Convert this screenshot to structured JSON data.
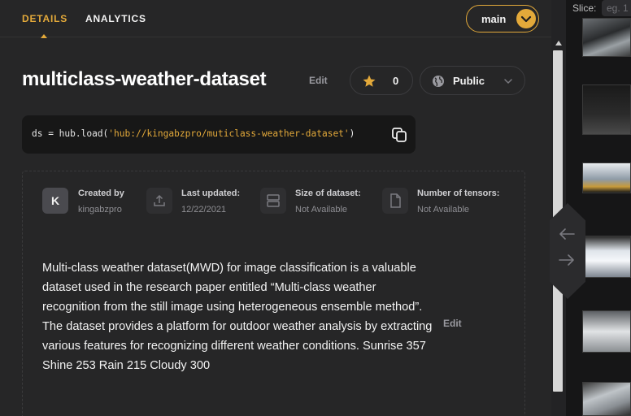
{
  "tabs": [
    {
      "label": "DETAILS",
      "active": true
    },
    {
      "label": "ANALYTICS",
      "active": false
    }
  ],
  "branch": {
    "label": "main"
  },
  "dataset": {
    "title": "multiclass-weather-dataset",
    "edit_label": "Edit",
    "stars": "0",
    "visibility": "Public",
    "code_prefix": "ds = hub.load(",
    "code_string": "'hub://kingabzpro/muticlass-weather-dataset'",
    "code_suffix": ")"
  },
  "info": {
    "avatar_letter": "K",
    "created_by": {
      "label": "Created by",
      "value": "kingabzpro"
    },
    "last_updated": {
      "label": "Last updated:",
      "value": "12/22/2021"
    },
    "size": {
      "label": "Size of dataset:",
      "value": "Not Available"
    },
    "tensors": {
      "label": "Number of tensors:",
      "value": "Not Available"
    }
  },
  "description": {
    "text": "Multi-class weather dataset(MWD) for image classification is a valuable dataset used in the research paper entitled “Multi-class weather recognition from the still image using heterogeneous ensemble method”. The dataset provides a platform for outdoor weather analysis by extracting various features for recognizing different weather conditions. Sunrise 357 Shine 253 Rain 215 Cloudy 300",
    "edit_label": "Edit"
  },
  "slice": {
    "label": "Slice:",
    "placeholder": "eg. 1"
  },
  "colors": {
    "accent": "#e3a93a",
    "panel": "#262627",
    "background": "#1c1c1e"
  },
  "icons": [
    "star-icon",
    "globe-icon",
    "chevron-down-icon",
    "copy-icon",
    "upload-icon",
    "storage-icon",
    "file-icon",
    "arrow-left-icon",
    "arrow-right-icon"
  ]
}
